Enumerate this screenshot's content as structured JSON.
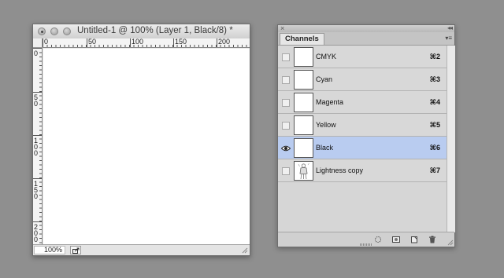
{
  "document": {
    "title": "Untitled-1 @ 100% (Layer 1, Black/8) *",
    "h_ruler_labels": [
      "0",
      "50",
      "100",
      "150",
      "200"
    ],
    "v_ruler_labels": [
      "0",
      "50",
      "100",
      "150",
      "200"
    ],
    "zoom": "100%"
  },
  "panel": {
    "tab_label": "Channels",
    "close_glyph": "×",
    "collapse_glyph": "◂◂",
    "menu_glyph": "▾≡",
    "channels": [
      {
        "name": "CMYK",
        "shortcut": "⌘2",
        "visible": false,
        "selected": false,
        "thumb": "blank"
      },
      {
        "name": "Cyan",
        "shortcut": "⌘3",
        "visible": false,
        "selected": false,
        "thumb": "blank"
      },
      {
        "name": "Magenta",
        "shortcut": "⌘4",
        "visible": false,
        "selected": false,
        "thumb": "blank"
      },
      {
        "name": "Yellow",
        "shortcut": "⌘5",
        "visible": false,
        "selected": false,
        "thumb": "blank"
      },
      {
        "name": "Black",
        "shortcut": "⌘6",
        "visible": true,
        "selected": true,
        "thumb": "blank"
      },
      {
        "name": "Lightness copy",
        "shortcut": "⌘7",
        "visible": false,
        "selected": false,
        "thumb": "figure"
      }
    ],
    "footer_icons": [
      "load-selection-icon",
      "save-selection-icon",
      "new-channel-icon",
      "trash-icon"
    ]
  },
  "colors": {
    "desktop": "#8f8f8f",
    "selected_row": "#b9ccf0",
    "panel_bg": "#d6d6d6"
  }
}
